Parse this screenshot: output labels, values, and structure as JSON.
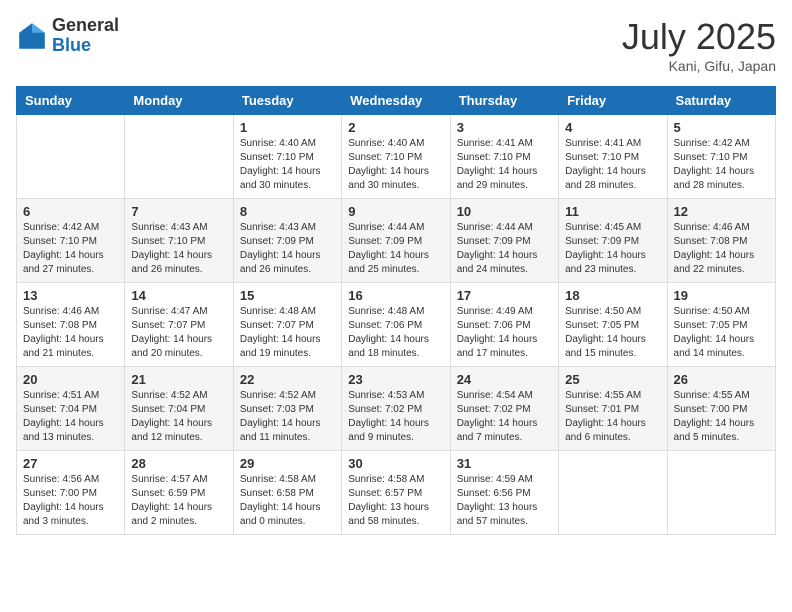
{
  "logo": {
    "general": "General",
    "blue": "Blue"
  },
  "title": "July 2025",
  "subtitle": "Kani, Gifu, Japan",
  "days_of_week": [
    "Sunday",
    "Monday",
    "Tuesday",
    "Wednesday",
    "Thursday",
    "Friday",
    "Saturday"
  ],
  "weeks": [
    [
      {
        "day": "",
        "info": ""
      },
      {
        "day": "",
        "info": ""
      },
      {
        "day": "1",
        "info": "Sunrise: 4:40 AM\nSunset: 7:10 PM\nDaylight: 14 hours and 30 minutes."
      },
      {
        "day": "2",
        "info": "Sunrise: 4:40 AM\nSunset: 7:10 PM\nDaylight: 14 hours and 30 minutes."
      },
      {
        "day": "3",
        "info": "Sunrise: 4:41 AM\nSunset: 7:10 PM\nDaylight: 14 hours and 29 minutes."
      },
      {
        "day": "4",
        "info": "Sunrise: 4:41 AM\nSunset: 7:10 PM\nDaylight: 14 hours and 28 minutes."
      },
      {
        "day": "5",
        "info": "Sunrise: 4:42 AM\nSunset: 7:10 PM\nDaylight: 14 hours and 28 minutes."
      }
    ],
    [
      {
        "day": "6",
        "info": "Sunrise: 4:42 AM\nSunset: 7:10 PM\nDaylight: 14 hours and 27 minutes."
      },
      {
        "day": "7",
        "info": "Sunrise: 4:43 AM\nSunset: 7:10 PM\nDaylight: 14 hours and 26 minutes."
      },
      {
        "day": "8",
        "info": "Sunrise: 4:43 AM\nSunset: 7:09 PM\nDaylight: 14 hours and 26 minutes."
      },
      {
        "day": "9",
        "info": "Sunrise: 4:44 AM\nSunset: 7:09 PM\nDaylight: 14 hours and 25 minutes."
      },
      {
        "day": "10",
        "info": "Sunrise: 4:44 AM\nSunset: 7:09 PM\nDaylight: 14 hours and 24 minutes."
      },
      {
        "day": "11",
        "info": "Sunrise: 4:45 AM\nSunset: 7:09 PM\nDaylight: 14 hours and 23 minutes."
      },
      {
        "day": "12",
        "info": "Sunrise: 4:46 AM\nSunset: 7:08 PM\nDaylight: 14 hours and 22 minutes."
      }
    ],
    [
      {
        "day": "13",
        "info": "Sunrise: 4:46 AM\nSunset: 7:08 PM\nDaylight: 14 hours and 21 minutes."
      },
      {
        "day": "14",
        "info": "Sunrise: 4:47 AM\nSunset: 7:07 PM\nDaylight: 14 hours and 20 minutes."
      },
      {
        "day": "15",
        "info": "Sunrise: 4:48 AM\nSunset: 7:07 PM\nDaylight: 14 hours and 19 minutes."
      },
      {
        "day": "16",
        "info": "Sunrise: 4:48 AM\nSunset: 7:06 PM\nDaylight: 14 hours and 18 minutes."
      },
      {
        "day": "17",
        "info": "Sunrise: 4:49 AM\nSunset: 7:06 PM\nDaylight: 14 hours and 17 minutes."
      },
      {
        "day": "18",
        "info": "Sunrise: 4:50 AM\nSunset: 7:05 PM\nDaylight: 14 hours and 15 minutes."
      },
      {
        "day": "19",
        "info": "Sunrise: 4:50 AM\nSunset: 7:05 PM\nDaylight: 14 hours and 14 minutes."
      }
    ],
    [
      {
        "day": "20",
        "info": "Sunrise: 4:51 AM\nSunset: 7:04 PM\nDaylight: 14 hours and 13 minutes."
      },
      {
        "day": "21",
        "info": "Sunrise: 4:52 AM\nSunset: 7:04 PM\nDaylight: 14 hours and 12 minutes."
      },
      {
        "day": "22",
        "info": "Sunrise: 4:52 AM\nSunset: 7:03 PM\nDaylight: 14 hours and 11 minutes."
      },
      {
        "day": "23",
        "info": "Sunrise: 4:53 AM\nSunset: 7:02 PM\nDaylight: 14 hours and 9 minutes."
      },
      {
        "day": "24",
        "info": "Sunrise: 4:54 AM\nSunset: 7:02 PM\nDaylight: 14 hours and 7 minutes."
      },
      {
        "day": "25",
        "info": "Sunrise: 4:55 AM\nSunset: 7:01 PM\nDaylight: 14 hours and 6 minutes."
      },
      {
        "day": "26",
        "info": "Sunrise: 4:55 AM\nSunset: 7:00 PM\nDaylight: 14 hours and 5 minutes."
      }
    ],
    [
      {
        "day": "27",
        "info": "Sunrise: 4:56 AM\nSunset: 7:00 PM\nDaylight: 14 hours and 3 minutes."
      },
      {
        "day": "28",
        "info": "Sunrise: 4:57 AM\nSunset: 6:59 PM\nDaylight: 14 hours and 2 minutes."
      },
      {
        "day": "29",
        "info": "Sunrise: 4:58 AM\nSunset: 6:58 PM\nDaylight: 14 hours and 0 minutes."
      },
      {
        "day": "30",
        "info": "Sunrise: 4:58 AM\nSunset: 6:57 PM\nDaylight: 13 hours and 58 minutes."
      },
      {
        "day": "31",
        "info": "Sunrise: 4:59 AM\nSunset: 6:56 PM\nDaylight: 13 hours and 57 minutes."
      },
      {
        "day": "",
        "info": ""
      },
      {
        "day": "",
        "info": ""
      }
    ]
  ]
}
